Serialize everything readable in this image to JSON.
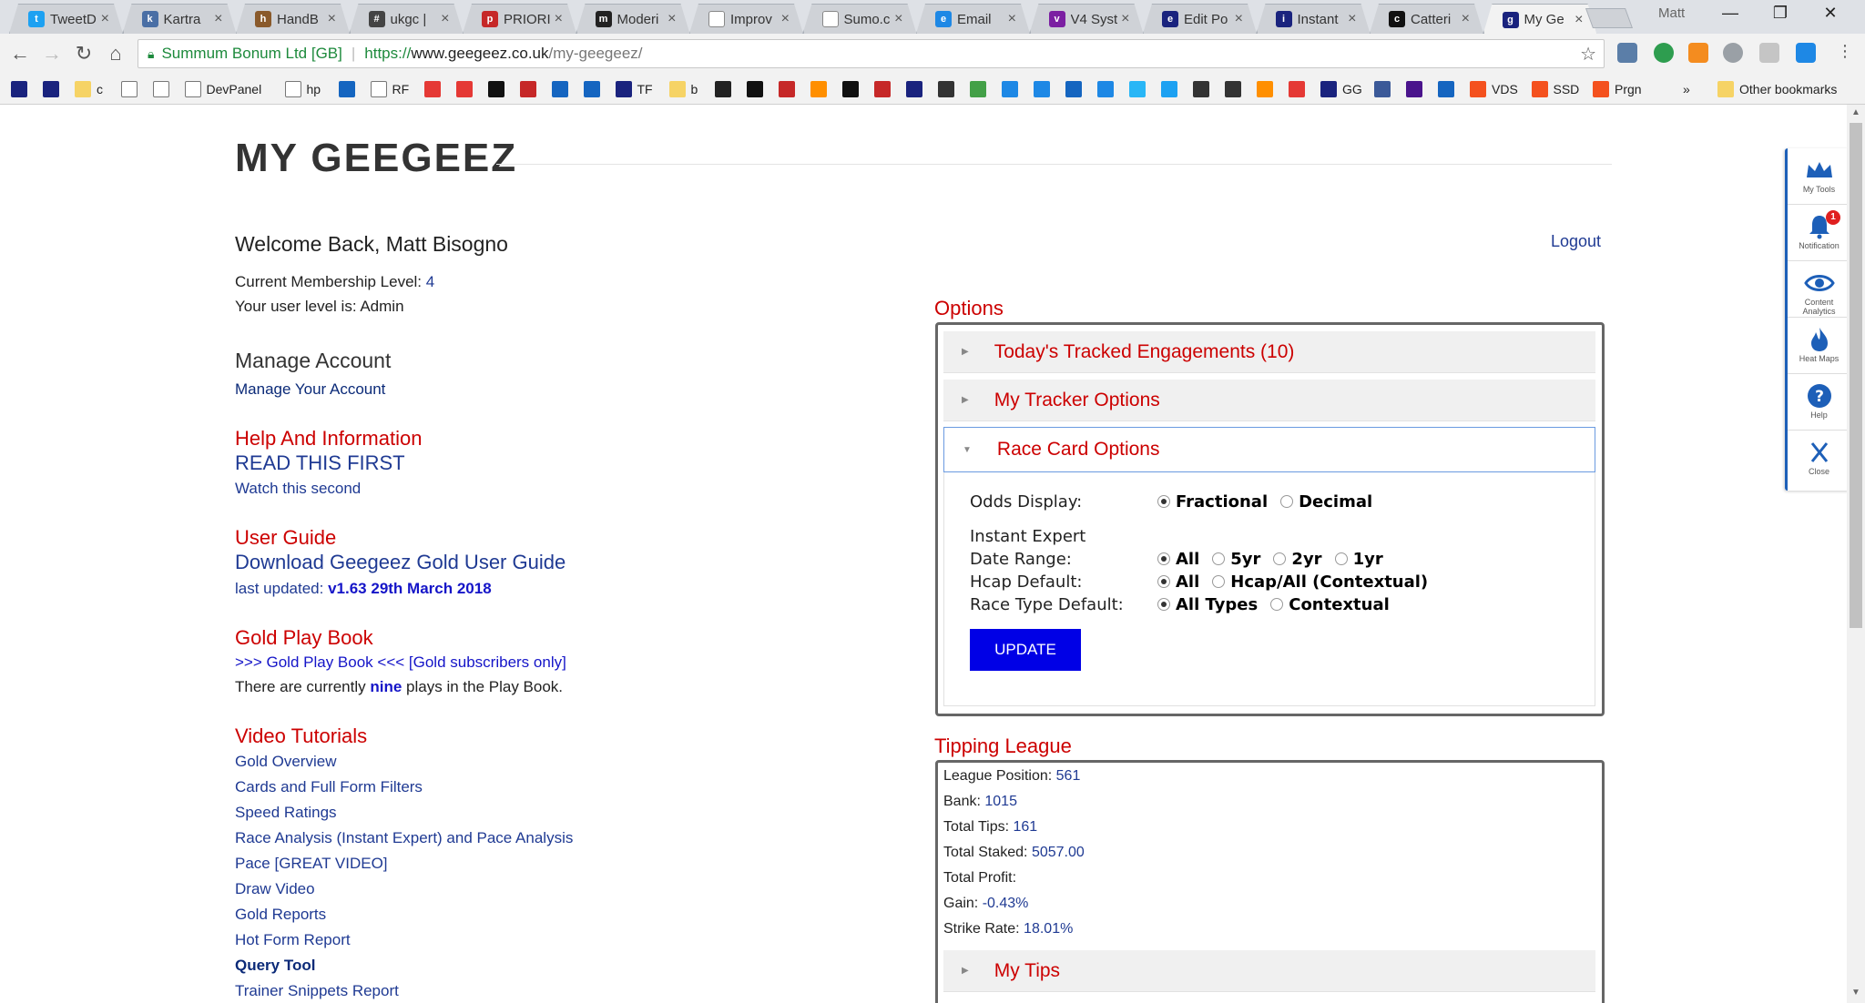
{
  "browser": {
    "tabs": [
      {
        "label": "TweetD",
        "color": "#1da1f2",
        "glyph": "t"
      },
      {
        "label": "Kartra",
        "color": "#4a6fa5",
        "glyph": "k"
      },
      {
        "label": "HandB",
        "color": "#8a5a2b",
        "glyph": "h"
      },
      {
        "label": "ukgc |",
        "color": "#444",
        "glyph": "#"
      },
      {
        "label": "PRIORI",
        "color": "#c62828",
        "glyph": "p"
      },
      {
        "label": "Moderi",
        "color": "#222",
        "glyph": "m"
      },
      {
        "label": "Improv",
        "color": "#888",
        "glyph": ""
      },
      {
        "label": "Sumo.c",
        "color": "#888",
        "glyph": ""
      },
      {
        "label": "Email",
        "color": "#1e88e5",
        "glyph": "e"
      },
      {
        "label": "V4 Syst",
        "color": "#7b1fa2",
        "glyph": "v"
      },
      {
        "label": "Edit Po",
        "color": "#1a237e",
        "glyph": "e"
      },
      {
        "label": "Instant",
        "color": "#1a237e",
        "glyph": "i"
      },
      {
        "label": "Catteri",
        "color": "#111",
        "glyph": "c"
      },
      {
        "label": "My Ge",
        "color": "#1a237e",
        "glyph": "g"
      }
    ],
    "profile": "Matt",
    "address": {
      "site_name": "Summum Bonum Ltd [GB]",
      "scheme": "https://",
      "host": "www.geegeez.co.uk",
      "path": "/my-geegeez/"
    },
    "bookmarks": [
      {
        "label": "",
        "color": "#1a237e"
      },
      {
        "label": "",
        "color": "#1a237e"
      },
      {
        "label": "c",
        "color": "#f6d365"
      },
      {
        "label": "",
        "color": "#fff"
      },
      {
        "label": "",
        "color": "#fff"
      },
      {
        "label": "DevPanel",
        "color": "#fff"
      },
      {
        "label": "hp",
        "color": "#fff"
      },
      {
        "label": "",
        "color": "#1565c0"
      },
      {
        "label": "RF",
        "color": "#fff"
      },
      {
        "label": "",
        "color": "#e53935"
      },
      {
        "label": "",
        "color": "#e53935"
      },
      {
        "label": "",
        "color": "#111"
      },
      {
        "label": "",
        "color": "#c62828"
      },
      {
        "label": "",
        "color": "#1565c0"
      },
      {
        "label": "",
        "color": "#1565c0"
      },
      {
        "label": "TF",
        "color": "#1a237e"
      },
      {
        "label": "b",
        "color": "#f6d365"
      },
      {
        "label": "",
        "color": "#222"
      },
      {
        "label": "",
        "color": "#111"
      },
      {
        "label": "",
        "color": "#c62828"
      },
      {
        "label": "",
        "color": "#ff8f00"
      },
      {
        "label": "",
        "color": "#111"
      },
      {
        "label": "",
        "color": "#c62828"
      },
      {
        "label": "",
        "color": "#1a237e"
      },
      {
        "label": "",
        "color": "#333"
      },
      {
        "label": "",
        "color": "#43a047"
      },
      {
        "label": "",
        "color": "#1e88e5"
      },
      {
        "label": "",
        "color": "#1e88e5"
      },
      {
        "label": "",
        "color": "#1565c0"
      },
      {
        "label": "",
        "color": "#1e88e5"
      },
      {
        "label": "",
        "color": "#29b6f6"
      },
      {
        "label": "",
        "color": "#1da1f2"
      },
      {
        "label": "",
        "color": "#333"
      },
      {
        "label": "",
        "color": "#333"
      },
      {
        "label": "",
        "color": "#ff8f00"
      },
      {
        "label": "",
        "color": "#e53935"
      },
      {
        "label": "GG",
        "color": "#1a237e"
      },
      {
        "label": "",
        "color": "#3b5998"
      },
      {
        "label": "",
        "color": "#4a148c"
      },
      {
        "label": "",
        "color": "#1565c0"
      },
      {
        "label": "VDS",
        "color": "#f4511e"
      },
      {
        "label": "SSD",
        "color": "#f4511e"
      },
      {
        "label": "Prgn",
        "color": "#f4511e"
      }
    ],
    "other_bookmarks": "Other bookmarks",
    "bookmarks_overflow": "»"
  },
  "page": {
    "title": "MY GEEGEEZ",
    "welcome": "Welcome Back, Matt Bisogno",
    "logout": "Logout",
    "membership_label": "Current Membership Level:",
    "membership_value": "4",
    "user_level": "Your user level is: Admin",
    "manage_heading": "Manage Account",
    "manage_link": "Manage Your Account",
    "help_heading": "Help And Information",
    "help_link_1": "READ THIS FIRST",
    "help_link_2": "Watch this second",
    "guide_heading": "User Guide",
    "guide_link": "Download Geegeez Gold User Guide",
    "guide_updated_label": "last updated:",
    "guide_updated_value": "v1.63 29th March 2018",
    "playbook_heading": "Gold Play Book",
    "playbook_link": ">>> Gold Play Book <<< [Gold subscribers only]",
    "playbook_text_1": "There are currently",
    "playbook_count": "nine",
    "playbook_text_2": "plays in the Play Book.",
    "video_heading": "Video Tutorials",
    "videos": [
      "Gold Overview",
      "Cards and Full Form Filters",
      "Speed Ratings",
      "Race Analysis (Instant Expert) and Pace Analysis",
      "Pace [GREAT VIDEO]",
      "Draw Video",
      "Gold Reports",
      "Hot Form Report",
      "Query Tool",
      "Trainer Snippets Report"
    ],
    "options_heading": "Options",
    "accordion": {
      "tracked": "Today's Tracked Engagements (10)",
      "tracker_options": "My Tracker Options",
      "race_card": "Race Card Options"
    },
    "race_card": {
      "odds_label": "Odds Display:",
      "odds_options": [
        "Fractional",
        "Decimal"
      ],
      "ie_label": "Instant Expert",
      "date_range_label": "Date Range:",
      "date_range_options": [
        "All",
        "5yr",
        "2yr",
        "1yr"
      ],
      "hcap_label": "Hcap Default:",
      "hcap_options": [
        "All",
        "Hcap/All (Contextual)"
      ],
      "race_type_label": "Race Type Default:",
      "race_type_options": [
        "All Types",
        "Contextual"
      ],
      "update_button": "UPDATE"
    },
    "tipping_heading": "Tipping League",
    "tipping": {
      "league_position_label": "League Position:",
      "league_position": "561",
      "bank_label": "Bank:",
      "bank": "1015",
      "total_tips_label": "Total Tips:",
      "total_tips": "161",
      "total_staked_label": "Total Staked:",
      "total_staked": "5057.00",
      "total_profit_label": "Total Profit:",
      "gain_label": "Gain:",
      "gain": "-0.43%",
      "strike_rate_label": "Strike Rate:",
      "strike_rate": "18.01%",
      "my_tips": "My Tips"
    },
    "tools": {
      "my_tools": "My Tools",
      "notification": "Notification",
      "notification_count": "1",
      "content_analytics_1": "Content",
      "content_analytics_2": "Analytics",
      "heat_maps": "Heat Maps",
      "help": "Help",
      "close": "Close"
    }
  }
}
